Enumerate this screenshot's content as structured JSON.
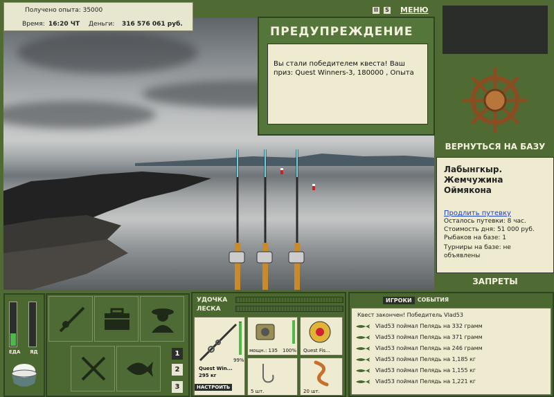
{
  "stats": {
    "xp_text": "Получено опыта: 35000",
    "time_label": "Время:",
    "time_value": "16:20 ЧТ",
    "money_label": "Деньги:",
    "money_value": "316 576 061 руб."
  },
  "top": {
    "pause": "II",
    "sound": "S",
    "menu": "МЕНЮ"
  },
  "warning": {
    "title": "ПРЕДУПРЕЖДЕНИЕ",
    "message": "Вы стали победителем квеста! Ваш приз: Quest Winners-3, 180000 , Опыта"
  },
  "right": {
    "return_label": "ВЕРНУТЬСЯ НА БАЗУ",
    "location": "Лабынгкыр. Жемчужина Оймякона",
    "extend_link": "Продлить путевку",
    "rows": [
      "Осталось путевки: 8 час.",
      "Стоимость дня: 51 000 руб.",
      "Рыбаков на базе: 1",
      "Турниры на базе: не объявлены"
    ],
    "bans_label": "ЗАПРЕТЫ"
  },
  "status": {
    "food_label": "ЕДА",
    "poison_label": "ЯД",
    "food_level": 0.28,
    "poison_level": 0.0
  },
  "pages": [
    "1",
    "2",
    "3"
  ],
  "tackle": {
    "rod_label": "УДОЧКА",
    "line_label": "ЛЕСКА",
    "rod_percent": "99%",
    "rod_name": "Quest Win...",
    "rod_weight": "295 кг",
    "adjust_button": "НАСТРОИТЬ",
    "reel_power": "мощн.: 135",
    "reel_percent": "100%",
    "line_name": "Quest Fis...",
    "hook_count": "5 шт.",
    "bait_count": "20 шт."
  },
  "chat": {
    "tab_players": "ИГРОКИ",
    "tab_events": "СОБЫТИЯ",
    "lines": [
      "Квест закончен! Победитель Vlad53",
      "Vlad53 поймал Пелядь на 332 грамм",
      "Vlad53 поймал Пелядь на 371 грамм",
      "Vlad53 поймал Пелядь на 246 грамм",
      "Vlad53 поймал Пелядь на 1,185 кг",
      "Vlad53 поймал Пелядь на 1,155 кг",
      "Vlad53 поймал Пелядь на 1,221 кг"
    ]
  }
}
